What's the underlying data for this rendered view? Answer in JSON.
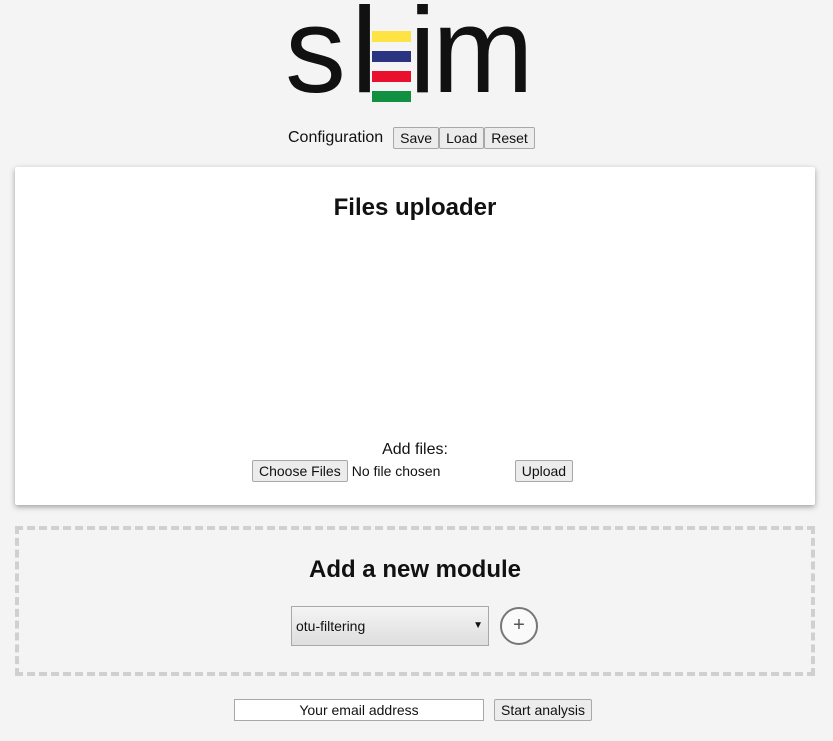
{
  "logo": {
    "text_s": "s",
    "text_l": "l",
    "text_im": "im",
    "bar_colors": [
      "#fde343",
      "#2a3480",
      "#e8102c",
      "#109040"
    ]
  },
  "config": {
    "label": "Configuration",
    "save_label": "Save",
    "load_label": "Load",
    "reset_label": "Reset"
  },
  "uploader": {
    "title": "Files uploader",
    "add_files_label": "Add files:",
    "choose_label": "Choose Files",
    "file_status": "No file chosen",
    "upload_label": "Upload"
  },
  "module": {
    "title": "Add a new module",
    "selected": "otu-filtering",
    "add_symbol": "+"
  },
  "footer": {
    "email_placeholder": "Your email address",
    "start_label": "Start analysis"
  }
}
